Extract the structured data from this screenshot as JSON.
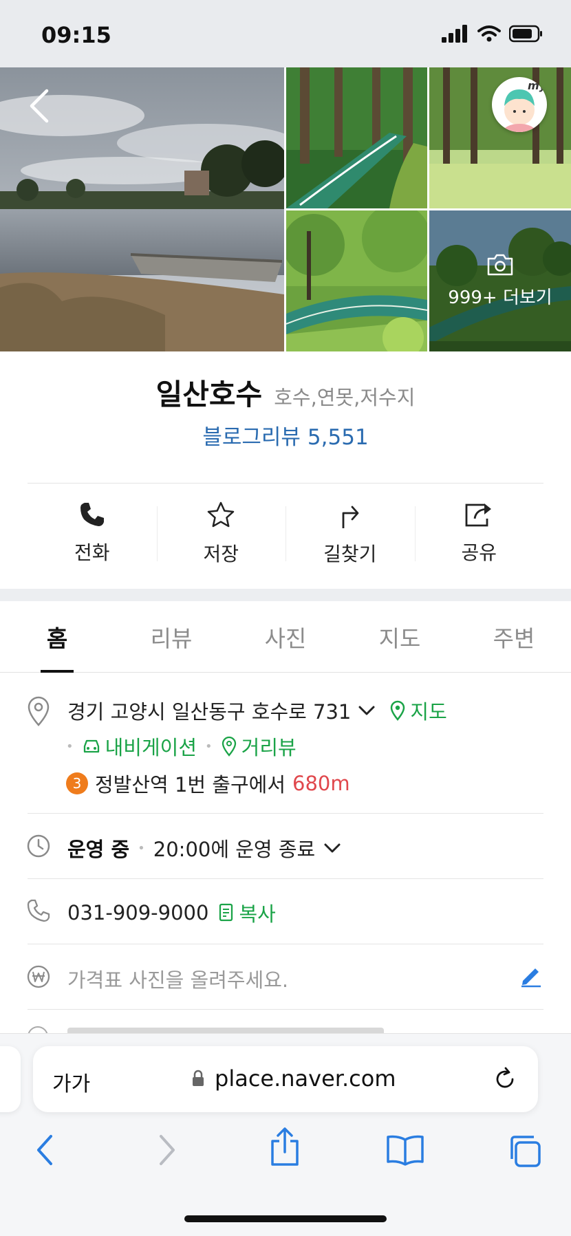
{
  "status_bar": {
    "time": "09:15"
  },
  "photos": {
    "more_label": "999+ 더보기"
  },
  "place": {
    "name": "일산호수",
    "category": "호수,연못,저수지",
    "review_label": "블로그리뷰",
    "review_count": "5,551"
  },
  "actions": [
    {
      "label": "전화",
      "icon": "phone-icon"
    },
    {
      "label": "저장",
      "icon": "star-icon"
    },
    {
      "label": "길찾기",
      "icon": "directions-icon"
    },
    {
      "label": "공유",
      "icon": "share-icon"
    }
  ],
  "tabs": [
    {
      "label": "홈",
      "active": true
    },
    {
      "label": "리뷰",
      "active": false
    },
    {
      "label": "사진",
      "active": false
    },
    {
      "label": "지도",
      "active": false
    },
    {
      "label": "주변",
      "active": false
    }
  ],
  "info": {
    "address": "경기 고양시 일산동구 호수로 731",
    "map_link": "지도",
    "navigation": "내비게이션",
    "street_view": "거리뷰",
    "subway_line": "3",
    "station": "정발산역 1번 출구에서",
    "distance": "680m",
    "hours_status": "운영 중",
    "hours_detail": "20:00에 운영 종료",
    "phone": "031-909-9000",
    "copy_label": "복사",
    "price_prompt": "가격표 사진을 올려주세요."
  },
  "browser": {
    "text_size_label": "가가",
    "url": "place.naver.com"
  },
  "colors": {
    "accent_green": "#1aa347",
    "review_blue": "#2a6bb0",
    "distance_red": "#e0474c",
    "subway_line3": "#ef7c1c",
    "ios_blue": "#2a7de1"
  }
}
